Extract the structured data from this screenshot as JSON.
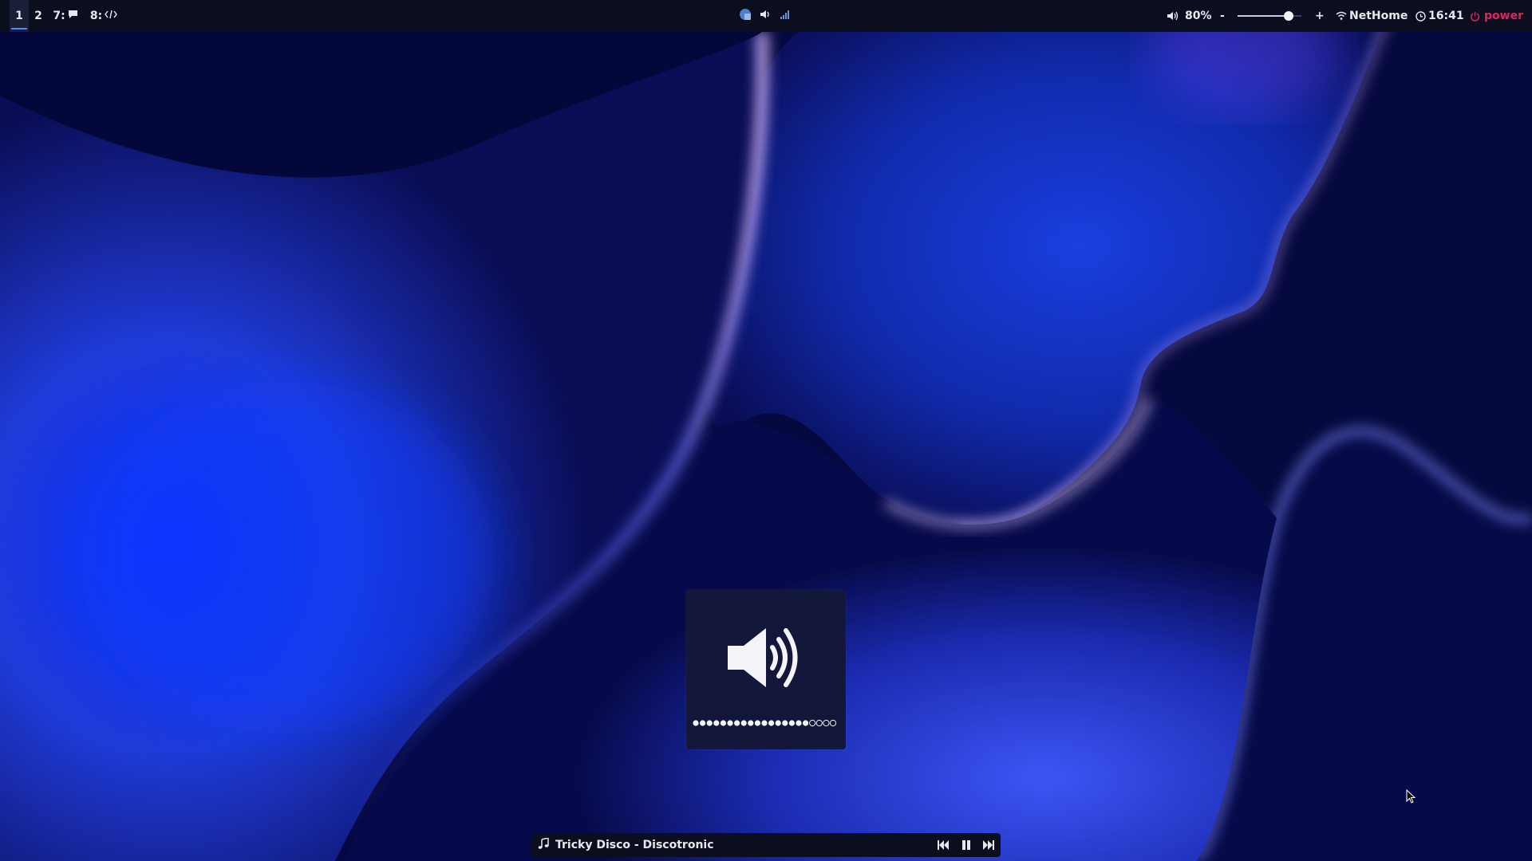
{
  "workspaces": [
    {
      "label": "1",
      "active": true
    },
    {
      "label": "2",
      "active": false
    },
    {
      "label": "7:",
      "icon": "chat-icon",
      "active": false
    },
    {
      "label": "8:",
      "icon": "code-icon",
      "active": false
    }
  ],
  "tray": {
    "icons": [
      "app-tray-icon",
      "speaker-tray-icon",
      "signal-bars-icon"
    ]
  },
  "volume": {
    "icon": "speaker-icon",
    "percent_label": "80%",
    "level": 0.8,
    "decrease_label": "-",
    "increase_label": "+"
  },
  "network": {
    "icon": "wifi-icon",
    "name": "NetHome"
  },
  "clock": {
    "icon": "clock-icon",
    "time": "16:41"
  },
  "power": {
    "icon": "power-icon",
    "label": "power",
    "color": "#e0245e"
  },
  "osd": {
    "icon": "speaker-loud-icon",
    "filled_dots": 17,
    "total_dots": 21
  },
  "media": {
    "icon": "music-note-icon",
    "title": "Tricky Disco - Discotronic",
    "controls": [
      "previous-icon",
      "pause-icon",
      "next-icon"
    ]
  },
  "colors": {
    "bar_bg": "#0b0e1e",
    "accent": "#4d8bff",
    "text": "#e6e8f0"
  }
}
